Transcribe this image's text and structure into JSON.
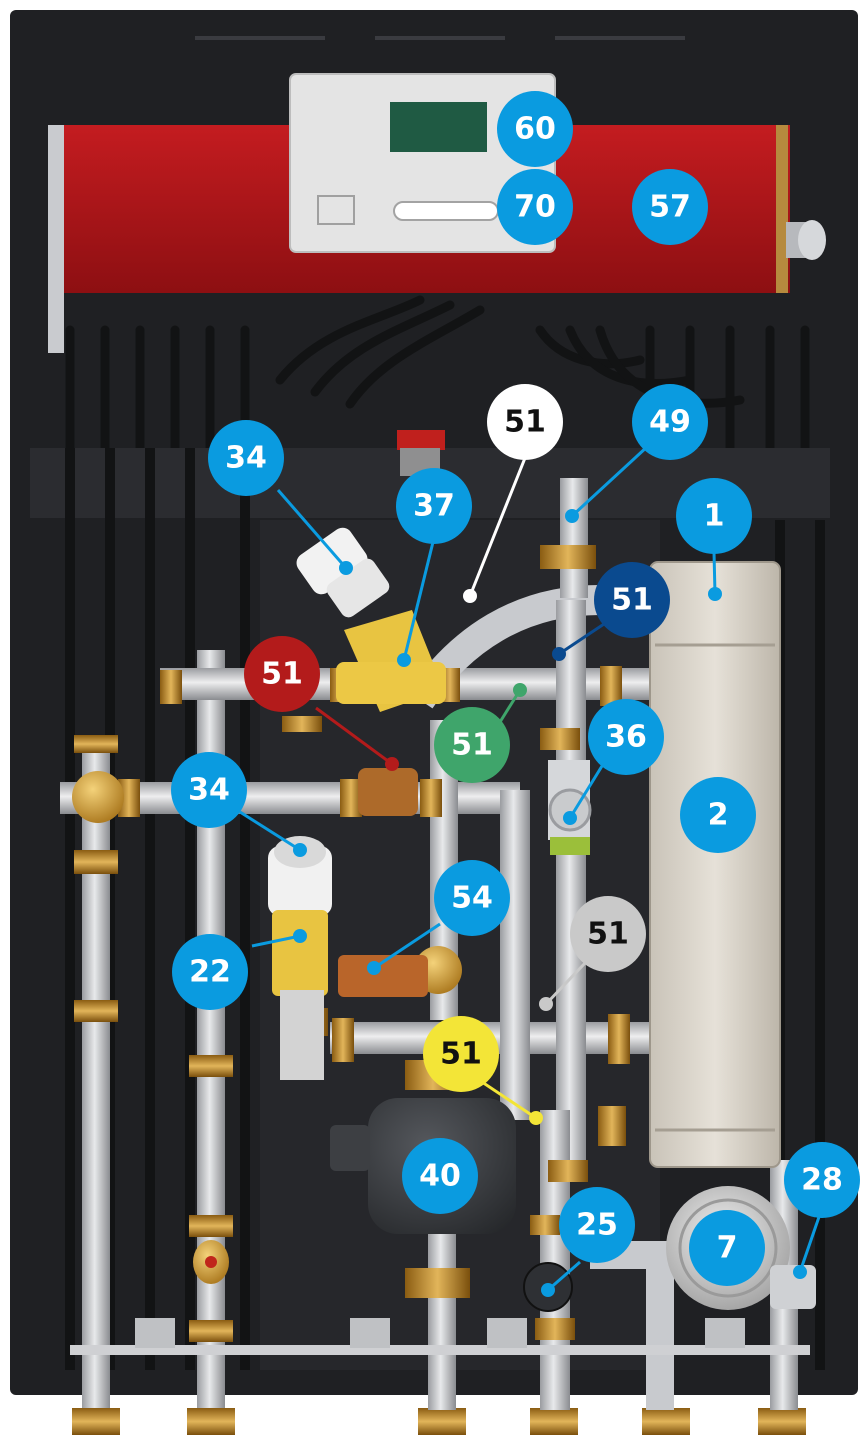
{
  "callouts": [
    {
      "text": "60",
      "fill": "#0a9be0",
      "color": "#ffffff"
    },
    {
      "text": "70",
      "fill": "#0a9be0",
      "color": "#ffffff"
    },
    {
      "text": "57",
      "fill": "#0a9be0",
      "color": "#ffffff"
    },
    {
      "text": "51",
      "fill": "#ffffff",
      "color": "#111111"
    },
    {
      "text": "49",
      "fill": "#0a9be0",
      "color": "#ffffff"
    },
    {
      "text": "34",
      "fill": "#0a9be0",
      "color": "#ffffff"
    },
    {
      "text": "37",
      "fill": "#0a9be0",
      "color": "#ffffff"
    },
    {
      "text": "1",
      "fill": "#0a9be0",
      "color": "#ffffff"
    },
    {
      "text": "51",
      "fill": "#0a4a8f",
      "color": "#ffffff"
    },
    {
      "text": "51",
      "fill": "#b31b1b",
      "color": "#ffffff"
    },
    {
      "text": "51",
      "fill": "#3fa56b",
      "color": "#ffffff"
    },
    {
      "text": "36",
      "fill": "#0a9be0",
      "color": "#ffffff"
    },
    {
      "text": "34",
      "fill": "#0a9be0",
      "color": "#ffffff"
    },
    {
      "text": "2",
      "fill": "#0a9be0",
      "color": "#ffffff"
    },
    {
      "text": "54",
      "fill": "#0a9be0",
      "color": "#ffffff"
    },
    {
      "text": "51",
      "fill": "#c9c9c9",
      "color": "#111111"
    },
    {
      "text": "22",
      "fill": "#0a9be0",
      "color": "#ffffff"
    },
    {
      "text": "51",
      "fill": "#f3e537",
      "color": "#111111"
    },
    {
      "text": "40",
      "fill": "#0a9be0",
      "color": "#ffffff"
    },
    {
      "text": "28",
      "fill": "#0a9be0",
      "color": "#ffffff"
    },
    {
      "text": "25",
      "fill": "#0a9be0",
      "color": "#ffffff"
    },
    {
      "text": "7",
      "fill": "#0a9be0",
      "color": "#ffffff"
    }
  ],
  "colors": {
    "cabinet": "#1c1d20",
    "red_panel": "#b5161a",
    "controller": "#e2e2e2",
    "pipe": "#d0d2d6",
    "brass": "#c98f2a",
    "heat_exchanger": "#dcd6cc"
  }
}
